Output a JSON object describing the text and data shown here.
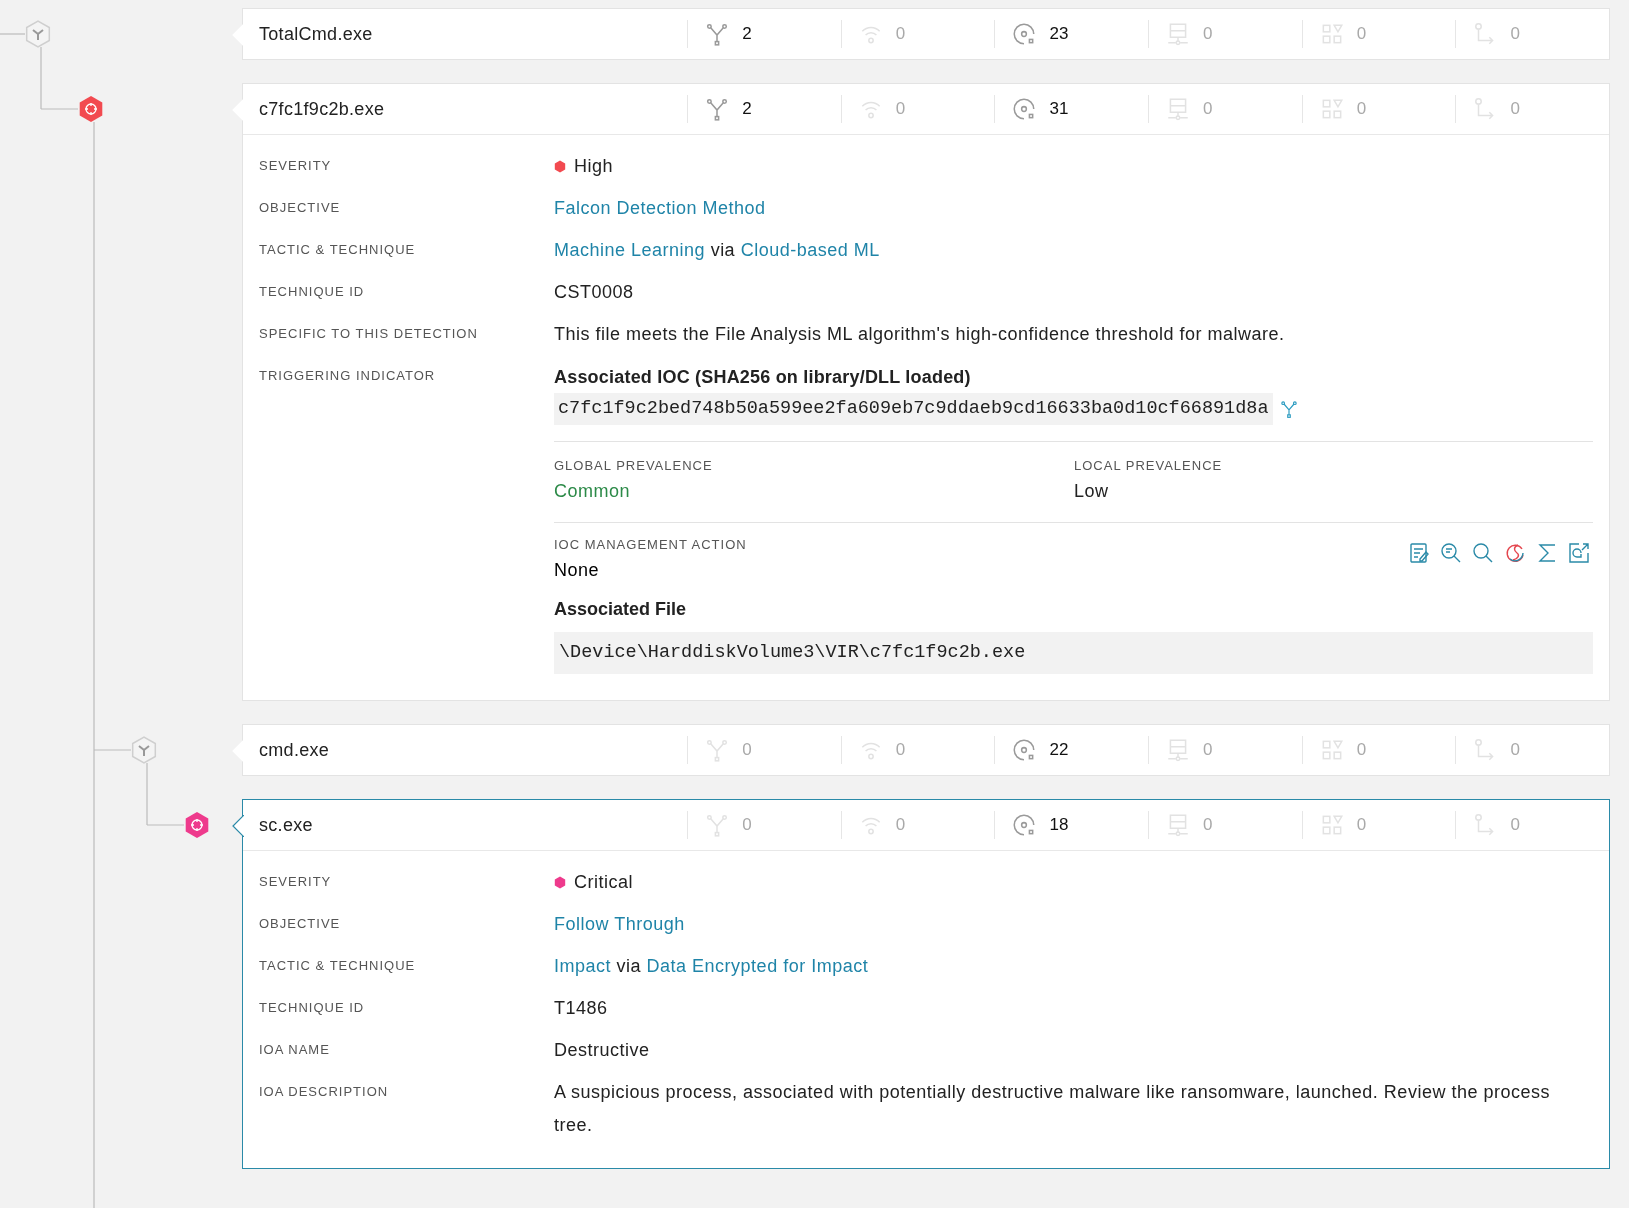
{
  "processes": [
    {
      "name": "TotalCmd.exe",
      "selected": false,
      "node": {
        "kind": "process"
      },
      "stats": [
        {
          "kind": "process",
          "value": "2",
          "active": true
        },
        {
          "kind": "network",
          "value": "0",
          "active": false
        },
        {
          "kind": "disk",
          "value": "23",
          "active": true
        },
        {
          "kind": "registry",
          "value": "0",
          "active": false
        },
        {
          "kind": "modules",
          "value": "0",
          "active": false
        },
        {
          "kind": "route",
          "value": "0",
          "active": false
        }
      ],
      "children": [
        {
          "name": "c7fc1f9c2b.exe",
          "selected": false,
          "node": {
            "kind": "detection",
            "color": "#f24a50"
          },
          "branch_continues": true,
          "stats": [
            {
              "kind": "process",
              "value": "2",
              "active": true
            },
            {
              "kind": "network",
              "value": "0",
              "active": false
            },
            {
              "kind": "disk",
              "value": "31",
              "active": true
            },
            {
              "kind": "registry",
              "value": "0",
              "active": false
            },
            {
              "kind": "modules",
              "value": "0",
              "active": false
            },
            {
              "kind": "route",
              "value": "0",
              "active": false
            }
          ],
          "details": [
            {
              "label": "SEVERITY",
              "kind": "severity",
              "value": "High",
              "color": "#f24a50"
            },
            {
              "label": "OBJECTIVE",
              "kind": "links",
              "parts": [
                {
                  "text": "Falcon Detection Method",
                  "link": true
                }
              ]
            },
            {
              "label": "TACTIC & TECHNIQUE",
              "kind": "links",
              "parts": [
                {
                  "text": "Machine Learning",
                  "link": true
                },
                {
                  "text": "via",
                  "link": false
                },
                {
                  "text": "Cloud-based ML",
                  "link": true
                }
              ]
            },
            {
              "label": "TECHNIQUE ID",
              "kind": "text",
              "value": "CST0008"
            },
            {
              "label": "SPECIFIC TO THIS DETECTION",
              "kind": "text",
              "value": "This file meets the File Analysis ML algorithm's high-confidence threshold for malware."
            },
            {
              "label": "TRIGGERING INDICATOR",
              "kind": "indicator",
              "title": "Associated IOC (SHA256 on library/DLL loaded)",
              "hash": "c7fc1f9c2bed748b50a599ee2fa609eb7c9ddaeb9cd16633ba0d10cf66891d8a",
              "prevalence": [
                {
                  "label": "GLOBAL PREVALENCE",
                  "value": "Common",
                  "color": "#2c8a48"
                },
                {
                  "label": "LOCAL PREVALENCE",
                  "value": "Low",
                  "color": "#222222"
                }
              ],
              "action": {
                "label": "IOC MANAGEMENT ACTION",
                "value": "None"
              },
              "actions": [
                {
                  "kind": "notes"
                },
                {
                  "kind": "zoom-list"
                },
                {
                  "kind": "search"
                },
                {
                  "kind": "remediate"
                },
                {
                  "kind": "sigma"
                },
                {
                  "kind": "external"
                }
              ],
              "file": {
                "title": "Associated File",
                "path": "\\Device\\HarddiskVolume3\\VIR\\c7fc1f9c2b.exe"
              }
            }
          ],
          "children": [
            {
              "name": "cmd.exe",
              "selected": false,
              "node": {
                "kind": "process"
              },
              "stats": [
                {
                  "kind": "process",
                  "value": "0",
                  "active": false
                },
                {
                  "kind": "network",
                  "value": "0",
                  "active": false
                },
                {
                  "kind": "disk",
                  "value": "22",
                  "active": true
                },
                {
                  "kind": "registry",
                  "value": "0",
                  "active": false
                },
                {
                  "kind": "modules",
                  "value": "0",
                  "active": false
                },
                {
                  "kind": "route",
                  "value": "0",
                  "active": false
                }
              ],
              "children": [
                {
                  "name": "sc.exe",
                  "selected": true,
                  "node": {
                    "kind": "detection",
                    "color": "#ee3a8c"
                  },
                  "stats": [
                    {
                      "kind": "process",
                      "value": "0",
                      "active": false
                    },
                    {
                      "kind": "network",
                      "value": "0",
                      "active": false
                    },
                    {
                      "kind": "disk",
                      "value": "18",
                      "active": true
                    },
                    {
                      "kind": "registry",
                      "value": "0",
                      "active": false
                    },
                    {
                      "kind": "modules",
                      "value": "0",
                      "active": false
                    },
                    {
                      "kind": "route",
                      "value": "0",
                      "active": false
                    }
                  ],
                  "details": [
                    {
                      "label": "SEVERITY",
                      "kind": "severity",
                      "value": "Critical",
                      "color": "#ee3a8c"
                    },
                    {
                      "label": "OBJECTIVE",
                      "kind": "links",
                      "parts": [
                        {
                          "text": "Follow Through",
                          "link": true
                        }
                      ]
                    },
                    {
                      "label": "TACTIC & TECHNIQUE",
                      "kind": "links",
                      "parts": [
                        {
                          "text": "Impact",
                          "link": true
                        },
                        {
                          "text": "via",
                          "link": false
                        },
                        {
                          "text": "Data Encrypted for Impact",
                          "link": true
                        }
                      ]
                    },
                    {
                      "label": "TECHNIQUE ID",
                      "kind": "text",
                      "value": "T1486"
                    },
                    {
                      "label": "IOA NAME",
                      "kind": "text",
                      "value": "Destructive"
                    },
                    {
                      "label": "IOA DESCRIPTION",
                      "kind": "text",
                      "value": "A suspicious process, associated with potentially destructive malware like ransomware, launched. Review the process tree."
                    }
                  ]
                }
              ]
            }
          ]
        }
      ]
    }
  ]
}
